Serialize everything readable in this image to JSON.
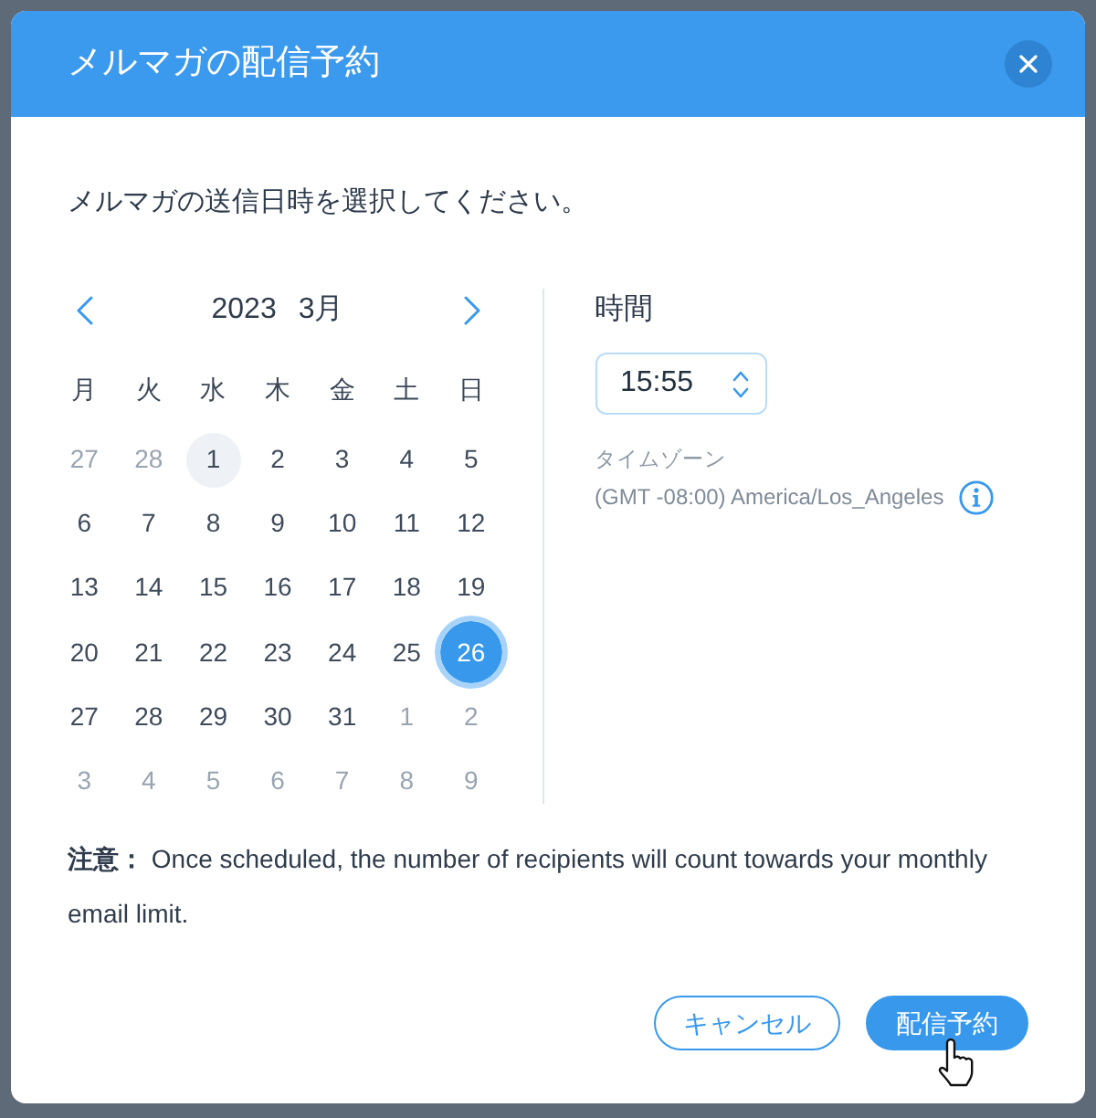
{
  "dialog": {
    "title": "メルマガの配信予約"
  },
  "instruction": "メルマガの送信日時を選択してください。",
  "calendar": {
    "year": "2023",
    "month": "3月",
    "weekdays": [
      "月",
      "火",
      "水",
      "木",
      "金",
      "土",
      "日"
    ],
    "weeks": [
      [
        {
          "day": "27",
          "muted": true,
          "today": false,
          "selected": false
        },
        {
          "day": "28",
          "muted": true,
          "today": false,
          "selected": false
        },
        {
          "day": "1",
          "muted": false,
          "today": true,
          "selected": false
        },
        {
          "day": "2",
          "muted": false,
          "today": false,
          "selected": false
        },
        {
          "day": "3",
          "muted": false,
          "today": false,
          "selected": false
        },
        {
          "day": "4",
          "muted": false,
          "today": false,
          "selected": false
        },
        {
          "day": "5",
          "muted": false,
          "today": false,
          "selected": false
        }
      ],
      [
        {
          "day": "6",
          "muted": false,
          "today": false,
          "selected": false
        },
        {
          "day": "7",
          "muted": false,
          "today": false,
          "selected": false
        },
        {
          "day": "8",
          "muted": false,
          "today": false,
          "selected": false
        },
        {
          "day": "9",
          "muted": false,
          "today": false,
          "selected": false
        },
        {
          "day": "10",
          "muted": false,
          "today": false,
          "selected": false
        },
        {
          "day": "11",
          "muted": false,
          "today": false,
          "selected": false
        },
        {
          "day": "12",
          "muted": false,
          "today": false,
          "selected": false
        }
      ],
      [
        {
          "day": "13",
          "muted": false,
          "today": false,
          "selected": false
        },
        {
          "day": "14",
          "muted": false,
          "today": false,
          "selected": false
        },
        {
          "day": "15",
          "muted": false,
          "today": false,
          "selected": false
        },
        {
          "day": "16",
          "muted": false,
          "today": false,
          "selected": false
        },
        {
          "day": "17",
          "muted": false,
          "today": false,
          "selected": false
        },
        {
          "day": "18",
          "muted": false,
          "today": false,
          "selected": false
        },
        {
          "day": "19",
          "muted": false,
          "today": false,
          "selected": false
        }
      ],
      [
        {
          "day": "20",
          "muted": false,
          "today": false,
          "selected": false
        },
        {
          "day": "21",
          "muted": false,
          "today": false,
          "selected": false
        },
        {
          "day": "22",
          "muted": false,
          "today": false,
          "selected": false
        },
        {
          "day": "23",
          "muted": false,
          "today": false,
          "selected": false
        },
        {
          "day": "24",
          "muted": false,
          "today": false,
          "selected": false
        },
        {
          "day": "25",
          "muted": false,
          "today": false,
          "selected": false
        },
        {
          "day": "26",
          "muted": false,
          "today": false,
          "selected": true
        }
      ],
      [
        {
          "day": "27",
          "muted": false,
          "today": false,
          "selected": false
        },
        {
          "day": "28",
          "muted": false,
          "today": false,
          "selected": false
        },
        {
          "day": "29",
          "muted": false,
          "today": false,
          "selected": false
        },
        {
          "day": "30",
          "muted": false,
          "today": false,
          "selected": false
        },
        {
          "day": "31",
          "muted": false,
          "today": false,
          "selected": false
        },
        {
          "day": "1",
          "muted": true,
          "today": false,
          "selected": false
        },
        {
          "day": "2",
          "muted": true,
          "today": false,
          "selected": false
        }
      ],
      [
        {
          "day": "3",
          "muted": true,
          "today": false,
          "selected": false
        },
        {
          "day": "4",
          "muted": true,
          "today": false,
          "selected": false
        },
        {
          "day": "5",
          "muted": true,
          "today": false,
          "selected": false
        },
        {
          "day": "6",
          "muted": true,
          "today": false,
          "selected": false
        },
        {
          "day": "7",
          "muted": true,
          "today": false,
          "selected": false
        },
        {
          "day": "8",
          "muted": true,
          "today": false,
          "selected": false
        },
        {
          "day": "9",
          "muted": true,
          "today": false,
          "selected": false
        }
      ]
    ]
  },
  "time": {
    "label": "時間",
    "value": "15:55"
  },
  "timezone": {
    "label": "タイムゾーン",
    "value": "(GMT -08:00) America/Los_Angeles"
  },
  "note": "**注意：** Once scheduled, the number of recipients will count towards your monthly email limit.",
  "buttons": [
    {
      "label": "キャンセル",
      "kind": "secondary",
      "hovered": false
    },
    {
      "label": "配信予約",
      "kind": "primary",
      "hovered": true
    }
  ]
}
